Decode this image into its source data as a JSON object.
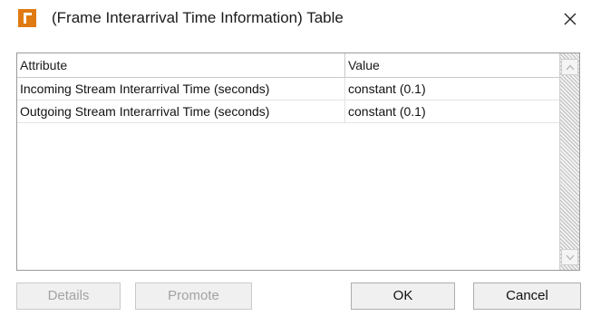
{
  "window": {
    "title": "(Frame Interarrival Time Information) Table",
    "close_glyph": "✕"
  },
  "table": {
    "columns": [
      "Attribute",
      "Value"
    ],
    "rows": [
      {
        "attribute": "Incoming Stream Interarrival Time (seconds)",
        "value": "constant (0.1)"
      },
      {
        "attribute": "Outgoing Stream Interarrival Time (seconds)",
        "value": "constant (0.1)"
      }
    ]
  },
  "buttons": {
    "details": "Details",
    "promote": "Promote",
    "ok": "OK",
    "cancel": "Cancel"
  },
  "colors": {
    "app_icon": "#e07a12"
  }
}
